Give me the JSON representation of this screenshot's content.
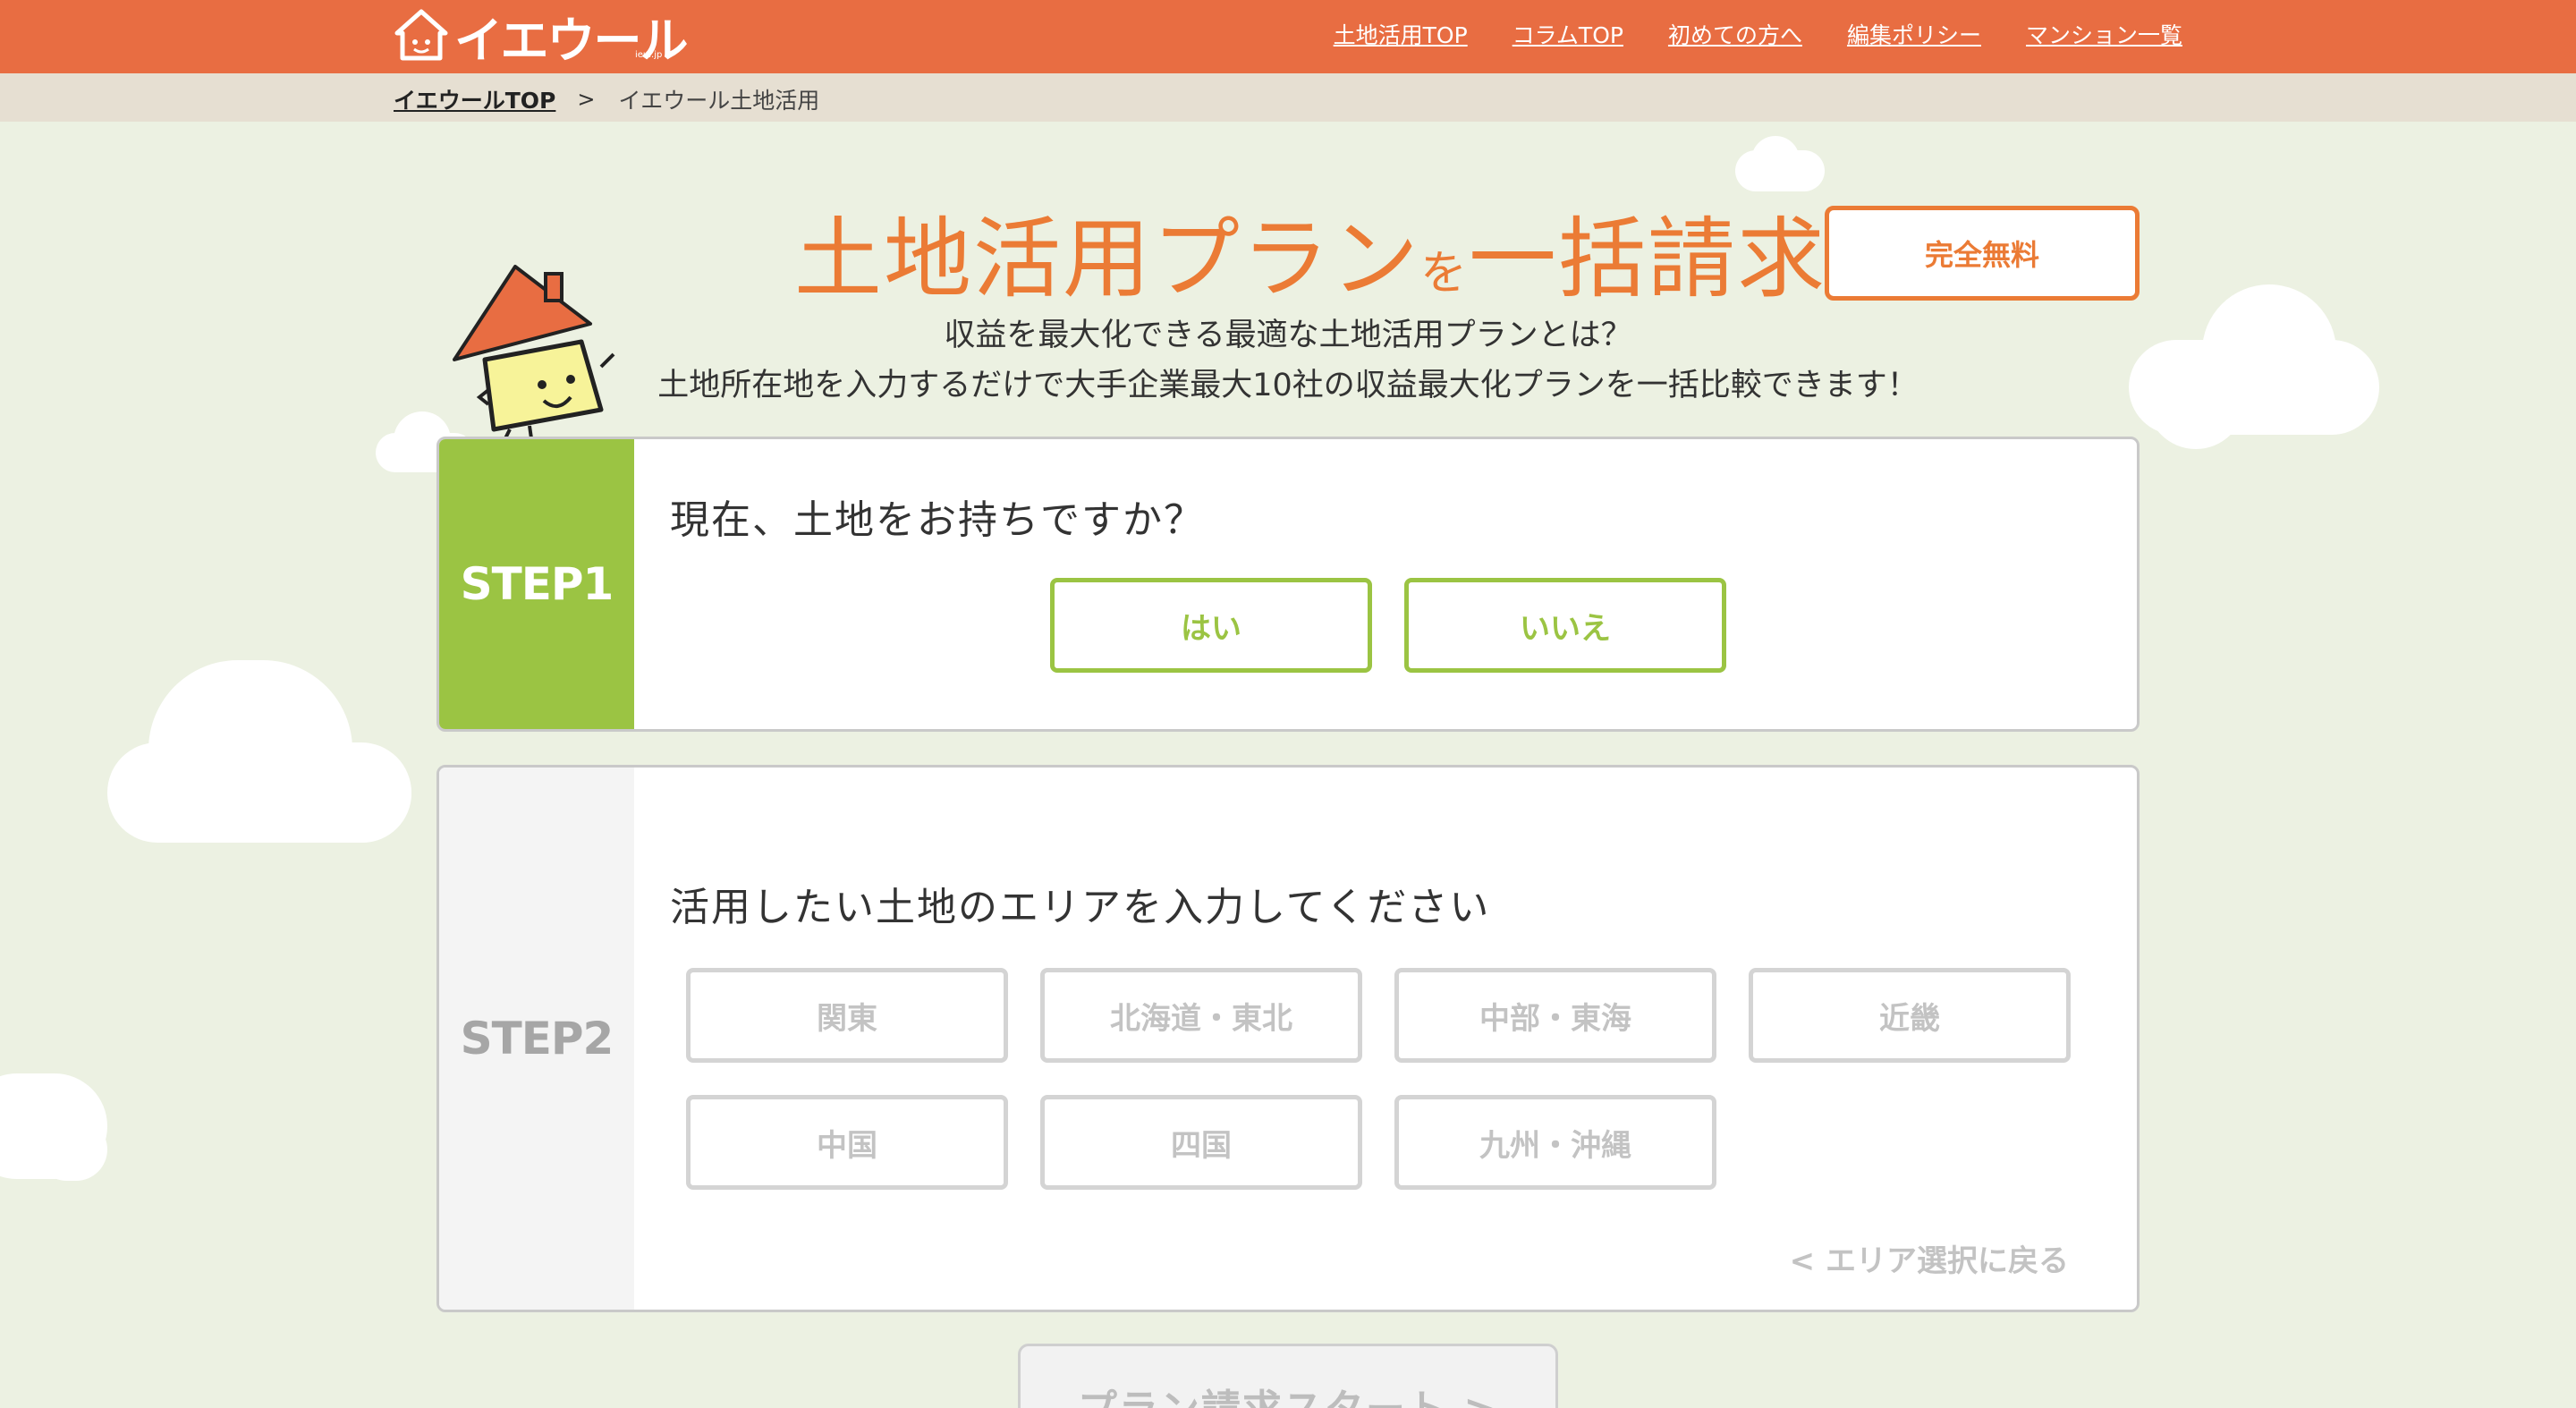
{
  "header": {
    "logo_text": "イエウール",
    "logo_sub": "ieul.jp",
    "nav": [
      "土地活用TOP",
      "コラムTOP",
      "初めての方へ",
      "編集ポリシー",
      "マンション一覧"
    ]
  },
  "breadcrumb": {
    "home": "イエウールTOP",
    "separator": ">",
    "current": "イエウール土地活用"
  },
  "hero": {
    "title_part1": "土地活用プラン",
    "title_wo": "を",
    "title_part2": "一括請求",
    "badge": "完全無料",
    "subtitle1": "収益を最大化できる最適な土地活用プランとは？",
    "subtitle2": "土地所在地を入力するだけで大手企業最大10社の収益最大化プランを一括比較できます！"
  },
  "step1": {
    "label": "STEP1",
    "question": "現在、土地をお持ちですか？",
    "yes": "はい",
    "no": "いいえ"
  },
  "step2": {
    "label": "STEP2",
    "question": "活用したい土地のエリアを入力してください",
    "areas": [
      "関東",
      "北海道・東北",
      "中部・東海",
      "近畿",
      "中国",
      "四国",
      "九州・沖縄"
    ],
    "back": "< エリア選択に戻る"
  },
  "start_button": "プラン請求スタート >",
  "colors": {
    "header": "#e86d42",
    "accent_orange": "#eb7b35",
    "step1_green": "#9bc443",
    "background": "#ecf1e2"
  }
}
